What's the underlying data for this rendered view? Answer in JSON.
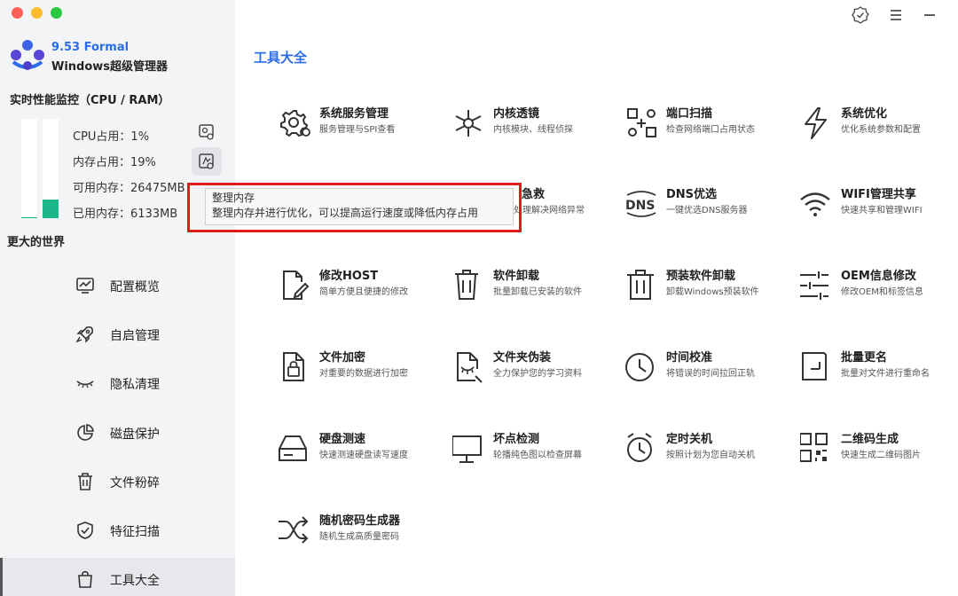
{
  "brand": {
    "version": "9.53 Formal",
    "name": "Windows超级管理器"
  },
  "monitor": {
    "title": "实时性能监控（CPU / RAM）",
    "cpu_label": "CPU占用：1%",
    "mem_label": "内存占用：19%",
    "avail_label": "可用内存：26475MB",
    "used_label": "已用内存：6133MB",
    "cpu_percent": 1,
    "mem_percent": 19
  },
  "sidebar": {
    "section_label": "更大的世界",
    "items": [
      {
        "label": "配置概览",
        "icon": "chart-monitor-icon"
      },
      {
        "label": "自启管理",
        "icon": "rocket-icon"
      },
      {
        "label": "隐私清理",
        "icon": "closed-eye-icon"
      },
      {
        "label": "磁盘保护",
        "icon": "pie-chart-icon"
      },
      {
        "label": "文件粉碎",
        "icon": "trash-icon"
      },
      {
        "label": "特征扫描",
        "icon": "shield-check-icon"
      },
      {
        "label": "工具大全",
        "icon": "bag-icon",
        "active": true
      }
    ]
  },
  "main": {
    "title": "工具大全",
    "tools": [
      {
        "name": "系统服务管理",
        "desc": "服务管理与SPI查看",
        "icon": "gear-cog-icon"
      },
      {
        "name": "内核透镜",
        "desc": "内核模块、线程侦探",
        "icon": "network-node-icon"
      },
      {
        "name": "端口扫描",
        "desc": "检查网络端口占用状态",
        "icon": "port-scan-icon"
      },
      {
        "name": "系统优化",
        "desc": "优化系统参数和配置",
        "icon": "lightning-icon"
      },
      {
        "name": "",
        "desc": "",
        "icon": "hidden-icon"
      },
      {
        "name": "急救",
        "desc": "处理解决网络异常",
        "icon": "hidden-icon"
      },
      {
        "name": "DNS优选",
        "desc": "一键优选DNS服务器",
        "icon": "dns-icon"
      },
      {
        "name": "WIFI管理共享",
        "desc": "快速共享和管理WIFI",
        "icon": "wifi-icon"
      },
      {
        "name": "修改HOST",
        "desc": "简单方便且便捷的修改",
        "icon": "edit-file-icon"
      },
      {
        "name": "软件卸载",
        "desc": "批量卸载已安装的软件",
        "icon": "trash-can-icon"
      },
      {
        "name": "预装软件卸载",
        "desc": "卸载Windows预装软件",
        "icon": "trash-bin-icon"
      },
      {
        "name": "OEM信息修改",
        "desc": "修改OEM和标签信息",
        "icon": "sliders-icon"
      },
      {
        "name": "文件加密",
        "desc": "对重要的数据进行加密",
        "icon": "file-lock-icon"
      },
      {
        "name": "文件夹伪装",
        "desc": "全力保护您的学习资料",
        "icon": "file-eye-icon"
      },
      {
        "name": "时间校准",
        "desc": "将错误的时间拉回正轨",
        "icon": "clock-icon"
      },
      {
        "name": "批量更名",
        "desc": "批量对文件进行重命名",
        "icon": "rename-icon"
      },
      {
        "name": "硬盘测速",
        "desc": "快速测速硬盘读写速度",
        "icon": "hard-drive-icon"
      },
      {
        "name": "坏点检测",
        "desc": "轮播纯色图以检查屏幕",
        "icon": "monitor-icon"
      },
      {
        "name": "定时关机",
        "desc": "按照计划为您自动关机",
        "icon": "alarm-clock-icon"
      },
      {
        "name": "二维码生成",
        "desc": "快速生成二维码图片",
        "icon": "qr-code-icon"
      },
      {
        "name": "随机密码生成器",
        "desc": "随机生成高质量密码",
        "icon": "shuffle-icon"
      }
    ]
  },
  "tooltip": {
    "title": "整理内存",
    "body": "整理内存并进行优化，可以提高运行速度或降低内存占用"
  },
  "colors": {
    "accent": "#2b6de8",
    "bar_fill": "#1db58a",
    "highlight": "#e01b1b"
  }
}
